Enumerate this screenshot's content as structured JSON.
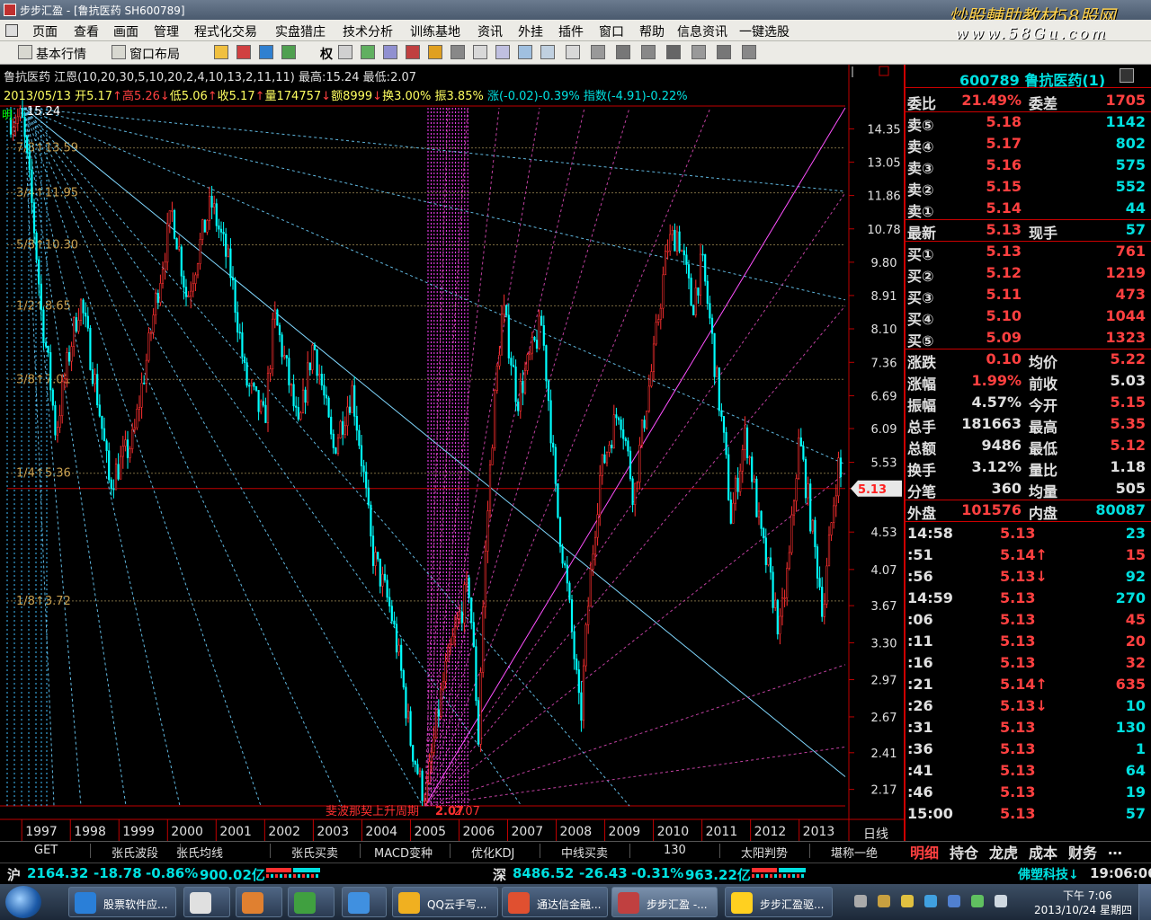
{
  "window": {
    "title": "步步汇盈 - [鲁抗医药 SH600789]"
  },
  "watermark": {
    "line1": "炒股輔助教材58股网",
    "line2": "www.58Gu.com"
  },
  "menu": [
    "页面",
    "查看",
    "画面",
    "管理",
    "程式化交易",
    "实盘猎庄",
    "技术分析",
    "训练基地",
    "资讯",
    "外挂",
    "插件",
    "窗口",
    "帮助",
    "信息资讯",
    "一键选股"
  ],
  "toolbar": {
    "market": "基本行情",
    "layout": "窗口布局",
    "rights": "权"
  },
  "legend": {
    "line1": "鲁抗医药 江恩(10,20,30,5,10,20,2,4,10,13,2,11,11) 最高:15.24 最低:2.07",
    "date": "2013/05/13",
    "open": "开5.17",
    "high": "高5.26",
    "low": "低5.06",
    "close": "收5.17",
    "vol": "量174757",
    "amt": "额8999",
    "turn": "换3.00%",
    "amp": "振3.85%",
    "chg": "涨(-0.02)-0.39%",
    "idx": "指数(-4.91)-0.22%"
  },
  "chart_data": {
    "type": "candlestick",
    "price_range": [
      2.07,
      15.24
    ],
    "y_ticks": [
      14.35,
      13.05,
      11.86,
      10.78,
      9.8,
      8.91,
      8.1,
      7.36,
      6.69,
      6.09,
      5.53,
      5.13,
      4.53,
      4.07,
      3.67,
      3.3,
      2.97,
      2.67,
      2.41,
      2.17
    ],
    "current_price": "5.13",
    "x_ticks": [
      "1997",
      "1998",
      "1999",
      "2000",
      "2001",
      "2002",
      "2003",
      "2004",
      "2005",
      "2006",
      "2007",
      "2008",
      "2009",
      "2010",
      "2011",
      "2012",
      "2013"
    ],
    "period_label": "日线",
    "gann_levels": [
      {
        "label": "7/8↑13.59",
        "value": 13.59
      },
      {
        "label": "3/4↑11.95",
        "value": 11.95
      },
      {
        "label": "5/8↑10.30",
        "value": 10.3
      },
      {
        "label": "1/2↑8.65",
        "value": 8.65
      },
      {
        "label": "3/8↑7.01",
        "value": 7.01
      },
      {
        "label": "1/4↑5.36",
        "value": 5.36
      },
      {
        "label": "1/8↑3.72",
        "value": 3.72
      }
    ],
    "top_label": "15.24",
    "low_label": "2.07",
    "cycle_label": "斐波那契上升周期",
    "cycle_value": "2.07",
    "ming_label": "明",
    "key_points": [
      {
        "x": 1997.0,
        "y": 14.8
      },
      {
        "x": 1997.4,
        "y": 8.5
      },
      {
        "x": 1997.7,
        "y": 6.0
      },
      {
        "x": 1998.2,
        "y": 8.8
      },
      {
        "x": 1998.8,
        "y": 5.2
      },
      {
        "x": 1999.3,
        "y": 5.9
      },
      {
        "x": 1999.6,
        "y": 7.6
      },
      {
        "x": 2000.1,
        "y": 11.3
      },
      {
        "x": 2000.4,
        "y": 8.8
      },
      {
        "x": 2000.9,
        "y": 11.6
      },
      {
        "x": 2001.3,
        "y": 9.5
      },
      {
        "x": 2001.6,
        "y": 7.0
      },
      {
        "x": 2002.0,
        "y": 6.2
      },
      {
        "x": 2002.2,
        "y": 8.4
      },
      {
        "x": 2002.7,
        "y": 6.0
      },
      {
        "x": 2003.0,
        "y": 7.8
      },
      {
        "x": 2003.4,
        "y": 5.7
      },
      {
        "x": 2003.8,
        "y": 6.8
      },
      {
        "x": 2004.2,
        "y": 4.3
      },
      {
        "x": 2004.6,
        "y": 3.6
      },
      {
        "x": 2005.0,
        "y": 2.5
      },
      {
        "x": 2005.3,
        "y": 2.07
      },
      {
        "x": 2005.7,
        "y": 3.0
      },
      {
        "x": 2006.2,
        "y": 3.9
      },
      {
        "x": 2006.4,
        "y": 2.5
      },
      {
        "x": 2006.9,
        "y": 8.6
      },
      {
        "x": 2007.2,
        "y": 6.6
      },
      {
        "x": 2007.7,
        "y": 8.2
      },
      {
        "x": 2008.0,
        "y": 4.9
      },
      {
        "x": 2008.3,
        "y": 3.5
      },
      {
        "x": 2008.5,
        "y": 2.6
      },
      {
        "x": 2008.9,
        "y": 5.3
      },
      {
        "x": 2009.3,
        "y": 6.5
      },
      {
        "x": 2009.6,
        "y": 5.0
      },
      {
        "x": 2010.0,
        "y": 7.4
      },
      {
        "x": 2010.3,
        "y": 10.3
      },
      {
        "x": 2010.5,
        "y": 10.7
      },
      {
        "x": 2010.8,
        "y": 8.6
      },
      {
        "x": 2011.0,
        "y": 9.8
      },
      {
        "x": 2011.3,
        "y": 7.0
      },
      {
        "x": 2011.6,
        "y": 4.7
      },
      {
        "x": 2011.9,
        "y": 6.0
      },
      {
        "x": 2012.2,
        "y": 4.5
      },
      {
        "x": 2012.6,
        "y": 3.4
      },
      {
        "x": 2012.8,
        "y": 4.2
      },
      {
        "x": 2013.0,
        "y": 5.9
      },
      {
        "x": 2013.3,
        "y": 4.4
      },
      {
        "x": 2013.5,
        "y": 3.6
      },
      {
        "x": 2013.8,
        "y": 5.5
      },
      {
        "x": 2013.9,
        "y": 5.13
      }
    ]
  },
  "panel": {
    "header": "600789 鲁抗医药(1)",
    "weibi_label": "委比",
    "weibi": "21.49%",
    "weicha_label": "委差",
    "weicha": "1705",
    "asks": [
      {
        "label": "卖⑤",
        "price": "5.18",
        "vol": "1142"
      },
      {
        "label": "卖④",
        "price": "5.17",
        "vol": "802"
      },
      {
        "label": "卖③",
        "price": "5.16",
        "vol": "575"
      },
      {
        "label": "卖②",
        "price": "5.15",
        "vol": "552"
      },
      {
        "label": "卖①",
        "price": "5.14",
        "vol": "44"
      }
    ],
    "latest_label": "最新",
    "latest": "5.13",
    "xianshou_label": "现手",
    "xianshou": "57",
    "bids": [
      {
        "label": "买①",
        "price": "5.13",
        "vol": "761"
      },
      {
        "label": "买②",
        "price": "5.12",
        "vol": "1219"
      },
      {
        "label": "买③",
        "price": "5.11",
        "vol": "473"
      },
      {
        "label": "买④",
        "price": "5.10",
        "vol": "1044"
      },
      {
        "label": "买⑤",
        "price": "5.09",
        "vol": "1323"
      }
    ],
    "stats": [
      {
        "l1": "涨跌",
        "v1": "0.10",
        "c1": "#ff4040",
        "l2": "均价",
        "v2": "5.22",
        "c2": "#ff4040"
      },
      {
        "l1": "涨幅",
        "v1": "1.99%",
        "c1": "#ff4040",
        "l2": "前收",
        "v2": "5.03",
        "c2": "#e0e0e0"
      },
      {
        "l1": "振幅",
        "v1": "4.57%",
        "c1": "#e0e0e0",
        "l2": "今开",
        "v2": "5.15",
        "c2": "#ff4040"
      },
      {
        "l1": "总手",
        "v1": "181663",
        "c1": "#e0e0e0",
        "l2": "最高",
        "v2": "5.35",
        "c2": "#ff4040"
      },
      {
        "l1": "总额",
        "v1": "9486",
        "c1": "#e0e0e0",
        "l2": "最低",
        "v2": "5.12",
        "c2": "#ff4040"
      },
      {
        "l1": "换手",
        "v1": "3.12%",
        "c1": "#e0e0e0",
        "l2": "量比",
        "v2": "1.18",
        "c2": "#e0e0e0"
      },
      {
        "l1": "分笔",
        "v1": "360",
        "c1": "#e0e0e0",
        "l2": "均量",
        "v2": "505",
        "c2": "#e0e0e0"
      }
    ],
    "outer_label": "外盘",
    "outer": "101576",
    "inner_label": "内盘",
    "inner": "80087",
    "ticks": [
      {
        "t": "14:58",
        "p": "5.13",
        "v": "23",
        "vc": "#00e0e0"
      },
      {
        "t": ":51",
        "p": "5.14↑",
        "v": "15",
        "vc": "#ff4040"
      },
      {
        "t": ":56",
        "p": "5.13↓",
        "v": "92",
        "vc": "#00e0e0"
      },
      {
        "t": "14:59",
        "p": "5.13",
        "v": "270",
        "vc": "#00e0e0"
      },
      {
        "t": ":06",
        "p": "5.13",
        "v": "45",
        "vc": "#ff4040"
      },
      {
        "t": ":11",
        "p": "5.13",
        "v": "20",
        "vc": "#ff4040"
      },
      {
        "t": ":16",
        "p": "5.13",
        "v": "32",
        "vc": "#ff4040"
      },
      {
        "t": ":21",
        "p": "5.14↑",
        "v": "635",
        "vc": "#ff4040"
      },
      {
        "t": ":26",
        "p": "5.13↓",
        "v": "10",
        "vc": "#00e0e0"
      },
      {
        "t": ":31",
        "p": "5.13",
        "v": "130",
        "vc": "#00e0e0"
      },
      {
        "t": ":36",
        "p": "5.13",
        "v": "1",
        "vc": "#00e0e0"
      },
      {
        "t": ":41",
        "p": "5.13",
        "v": "64",
        "vc": "#00e0e0"
      },
      {
        "t": ":46",
        "p": "5.13",
        "v": "19",
        "vc": "#00e0e0"
      },
      {
        "t": "15:00",
        "p": "5.13",
        "v": "57",
        "vc": "#00e0e0"
      }
    ]
  },
  "indicator_tabs": [
    "GET",
    "张氏波段",
    "张氏均线",
    "张氏买卖",
    "MACD变种",
    "优化KDJ",
    "中线买卖",
    "130",
    "太阳判势",
    "堪称一绝"
  ],
  "right_tabs": [
    "明细",
    "持仓",
    "龙虎",
    "成本",
    "财务",
    "…"
  ],
  "status": {
    "sh_label": "沪",
    "sh_index": "2164.32",
    "sh_chg": "-18.78",
    "sh_pct": "-0.86%",
    "sh_amt": "900.02亿",
    "sz_label": "深",
    "sz_index": "8486.52",
    "sz_chg": "-26.43",
    "sz_pct": "-0.31%",
    "sz_amt": "963.22亿",
    "news": "佛塑科技↓",
    "time": "19:06:06"
  },
  "taskbar": {
    "tasks": [
      "股票软件应...",
      "",
      "",
      "",
      "",
      "QQ云手写...",
      "通达信金融...",
      "步步汇盈 -...",
      "步步汇盈驱..."
    ],
    "clock_time": "下午 7:06",
    "clock_date": "2013/10/24 星期四"
  },
  "colors": {
    "up": "#ff3030",
    "down": "#00ffff",
    "grid": "#c00000",
    "gann": "#c8a050",
    "fan": "#a0e0ff",
    "magenta": "#ff40ff"
  }
}
